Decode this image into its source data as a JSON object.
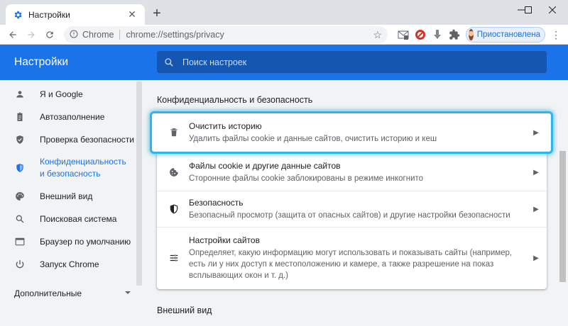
{
  "browser": {
    "tab": {
      "title": "Настройки",
      "close": "✕"
    },
    "new_tab": "+",
    "omnibox": {
      "origin": "Chrome",
      "url": "chrome://settings/privacy"
    },
    "profile": {
      "label": "Приостановлена"
    }
  },
  "settings": {
    "title": "Настройки",
    "search_placeholder": "Поиск настроек"
  },
  "sidebar": {
    "items": [
      {
        "label": "Я и Google",
        "icon": "person-icon"
      },
      {
        "label": "Автозаполнение",
        "icon": "clipboard-icon"
      },
      {
        "label": "Проверка безопасности",
        "icon": "shield-check-icon"
      },
      {
        "label": "Конфиденциальность и безопасность",
        "icon": "shield-icon",
        "active": true
      },
      {
        "label": "Внешний вид",
        "icon": "palette-icon"
      },
      {
        "label": "Поисковая система",
        "icon": "search-icon"
      },
      {
        "label": "Браузер по умолчанию",
        "icon": "browser-icon"
      },
      {
        "label": "Запуск Chrome",
        "icon": "power-icon"
      }
    ],
    "advanced_label": "Дополнительные"
  },
  "main": {
    "privacy_section_title": "Конфиденциальность и безопасность",
    "rows": [
      {
        "title": "Очистить историю",
        "desc": "Удалить файлы cookie и данные сайтов, очистить историю и кеш",
        "icon": "trash-icon"
      },
      {
        "title": "Файлы cookie и другие данные сайтов",
        "desc": "Сторонние файлы cookie заблокированы в режиме инкогнито",
        "icon": "cookie-icon"
      },
      {
        "title": "Безопасность",
        "desc": "Безопасный просмотр (защита от опасных сайтов) и другие настройки безопасности",
        "icon": "shield-half-icon"
      },
      {
        "title": "Настройки сайтов",
        "desc": "Определяет, какую информацию могут использовать и показывать сайты (например, есть ли у них доступ к местоположению и камере, а также разрешение на показ всплывающих окон и т. д.)",
        "icon": "sliders-icon"
      }
    ],
    "appearance_section_title": "Внешний вид"
  },
  "colors": {
    "accent": "#1a73e8",
    "highlight": "#30b5e8"
  }
}
